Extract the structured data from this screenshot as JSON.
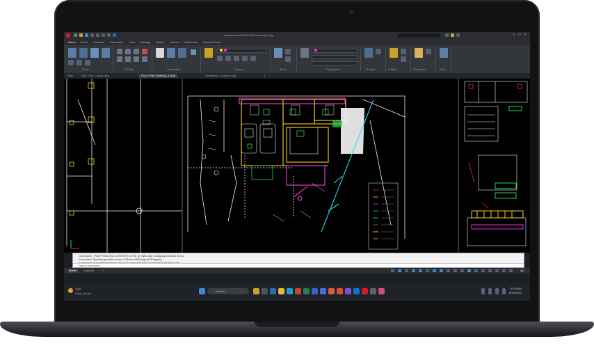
{
  "window": {
    "title": "Autodesk AutoCAD 2024  Drawing1.dwg",
    "search_placeholder": "Type a keyword or phrase"
  },
  "ribbon": {
    "tabs": [
      "Home",
      "Insert",
      "Annotate",
      "Parametric",
      "View",
      "Manage",
      "Output",
      "Add-ins",
      "Collaborate",
      "Express Tools"
    ],
    "active_tab": "Home",
    "panels": [
      "Draw",
      "Modify",
      "Annotation",
      "Layers",
      "Block",
      "Properties",
      "Groups",
      "Utilities",
      "Clipboard",
      "View"
    ]
  },
  "doc_tabs": [
    "Start",
    "Site_Plan_Layout.dwg",
    "Floor_Plan_Building_A.dwg",
    "Elevations_Sections.dwg"
  ],
  "active_doc_tab": 2,
  "command_line": {
    "history": [
      "Command: _PAN  Press ESC or ENTER to exit, or right-click to display shortcut menu.",
      "Command: Specify opposite corner or [Fence/WPolygon/CPolygon]:",
      "Command: *Cancel*  Automatic save to C:\\Users\\Public\\Documents\\Drawing1.sv$ ..."
    ],
    "input_placeholder": "Type a command"
  },
  "layout_tabs": [
    "Model",
    "Layout1"
  ],
  "active_layout_tab": "Model",
  "taskbar": {
    "weather_temp": "72°F",
    "weather_desc": "Partly cloudy",
    "search_label": "Search",
    "time": "10:24 AM",
    "date": "6/14/2024"
  },
  "colors": {
    "accent": "#3c8bd6",
    "cad_yellow": "#f5d327",
    "cad_magenta": "#e636d8",
    "cad_green": "#29d651",
    "cad_cyan": "#2fd7e6",
    "cad_white": "#f2f2f2",
    "cad_red": "#e03131"
  }
}
